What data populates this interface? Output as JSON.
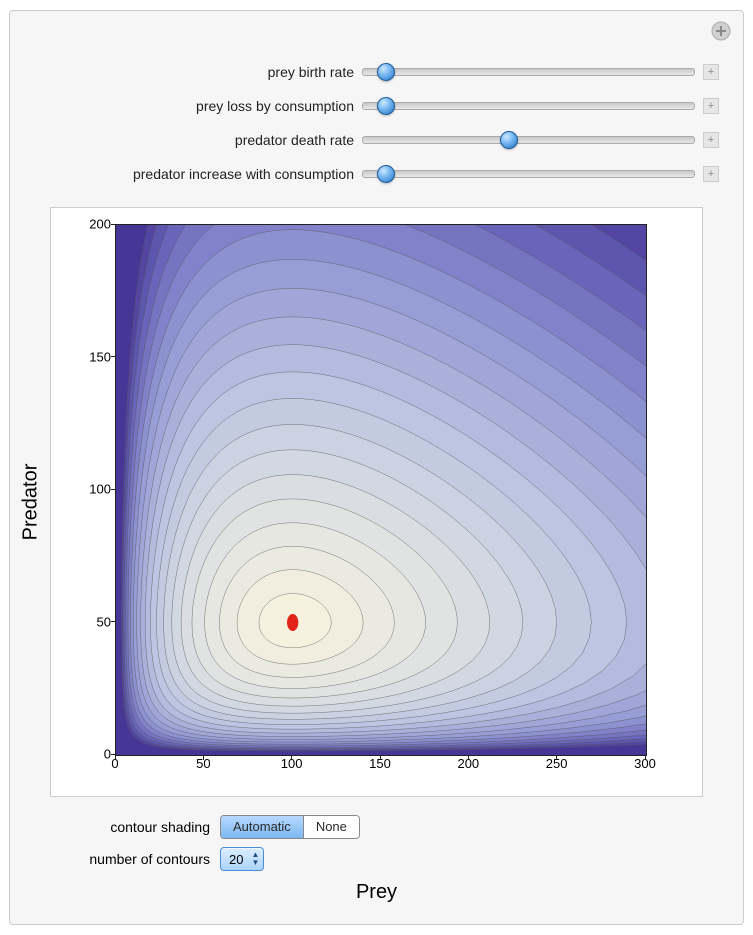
{
  "sliders": [
    {
      "label": "prey birth rate",
      "position": 7
    },
    {
      "label": "prey loss by consumption",
      "position": 7
    },
    {
      "label": "predator death rate",
      "position": 44
    },
    {
      "label": "predator increase with consumption",
      "position": 7
    }
  ],
  "chart_data": {
    "type": "contour",
    "xlabel": "Prey",
    "ylabel": "Predator",
    "xlim": [
      0,
      300
    ],
    "ylim": [
      0,
      200
    ],
    "x_ticks": [
      0,
      50,
      100,
      150,
      200,
      250,
      300
    ],
    "y_ticks": [
      0,
      50,
      100,
      150,
      200
    ],
    "equilibrium_point": {
      "x": 100,
      "y": 50
    },
    "num_contours": 20,
    "shading": "Automatic",
    "colormap": "cream-to-purple"
  },
  "controls": {
    "contour_shading_label": "contour shading",
    "shading_options": [
      "Automatic",
      "None"
    ],
    "shading_selected": "Automatic",
    "num_contours_label": "number of contours",
    "num_contours_value": "20"
  }
}
